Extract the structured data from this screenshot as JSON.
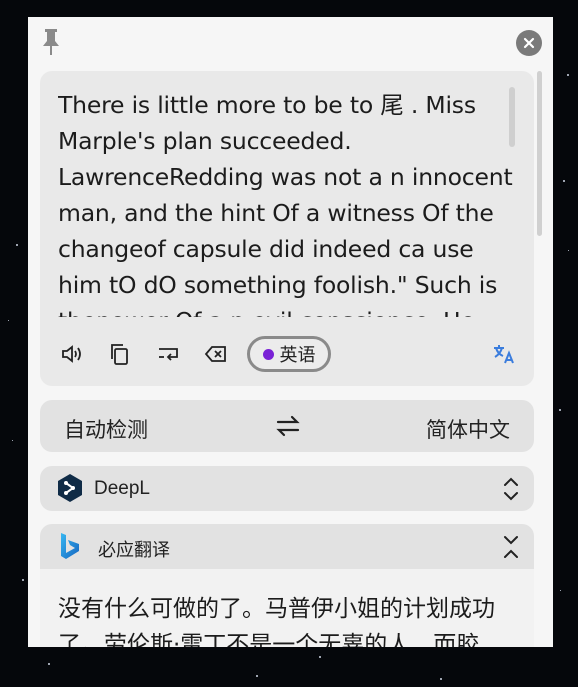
{
  "source": {
    "text": "There is little more to be to 尾 .   Miss Marple's plan succeeded. LawrenceRedding was not a n innocent man, and the hint Of a witness Of the changeof capsule did indeed ca use him tO dO something foolish.\" Such is thepower Of a n evil conscience. He",
    "detected_language": "英语"
  },
  "toolbar": {
    "icons": [
      "speaker-icon",
      "copy-icon",
      "wrap-icon",
      "clear-icon",
      "translate-icon"
    ]
  },
  "language_bar": {
    "from": "自动检测",
    "to": "简体中文"
  },
  "services": [
    {
      "name": "DeepL",
      "expanded": false
    },
    {
      "name": "必应翻译",
      "expanded": true,
      "result": "没有什么可做的了。马普伊小姐的计划成功了。劳伦斯·雷丁不是一个无辜的人，而胶"
    }
  ],
  "colors": {
    "accent": "#3b7ddd",
    "lang_dot": "#7a22d6",
    "deepl": "#0f2b46",
    "bing": "#1e8fd8"
  }
}
